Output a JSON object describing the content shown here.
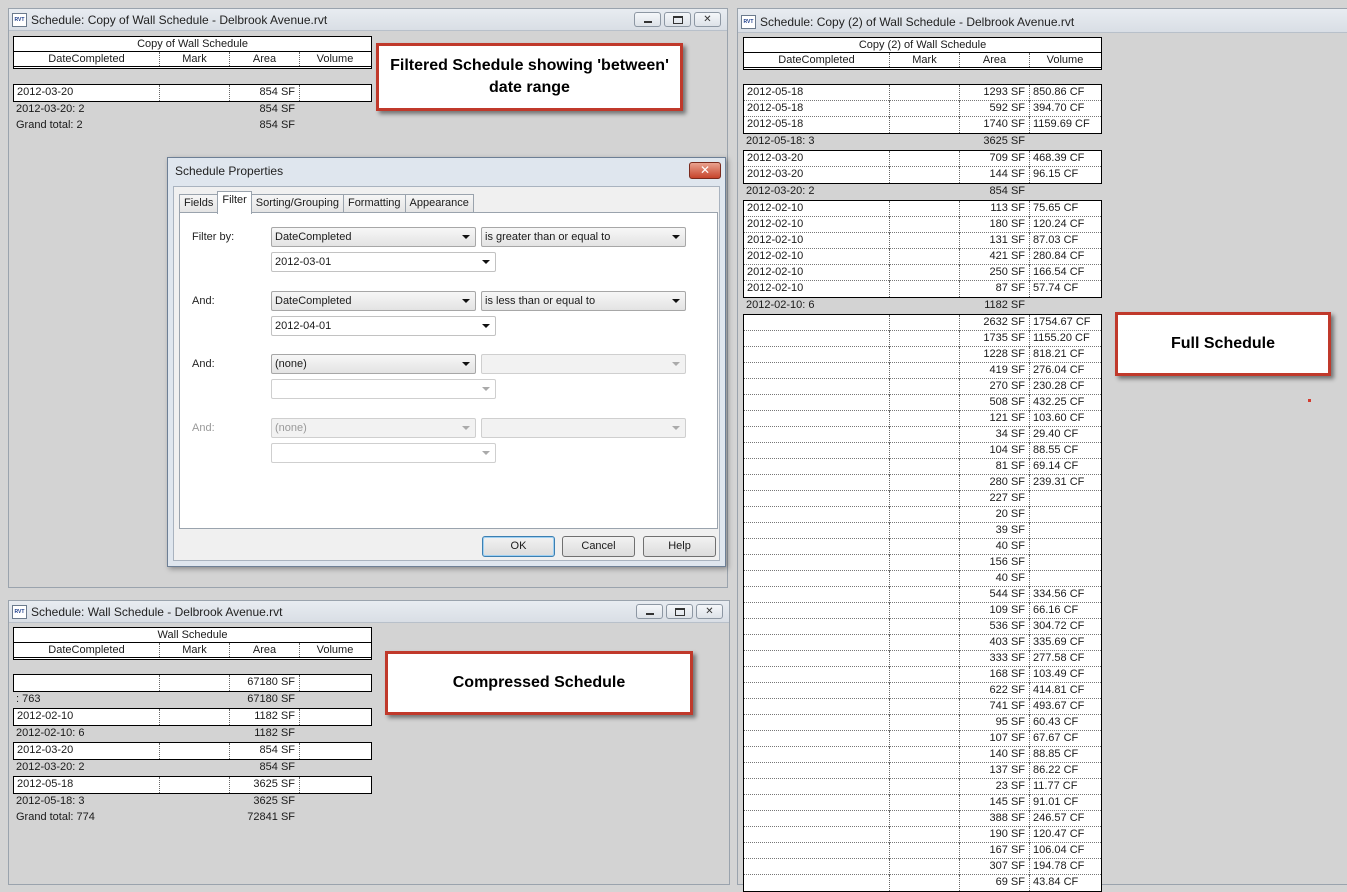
{
  "top_left_window": {
    "title": "Schedule: Copy of Wall Schedule - Delbrook Avenue.rvt",
    "schedule_title": "Copy of Wall Schedule",
    "columns": [
      "DateCompleted",
      "Mark",
      "Area",
      "Volume"
    ],
    "rows": [
      {
        "type": "data",
        "date": "2012-03-20",
        "mark": "",
        "area": "854 SF",
        "volume": ""
      },
      {
        "type": "summary",
        "date": "2012-03-20: 2",
        "mark": "",
        "area": "854 SF",
        "volume": ""
      },
      {
        "type": "summary",
        "date": "Grand total: 2",
        "mark": "",
        "area": "854 SF",
        "volume": ""
      }
    ]
  },
  "bottom_left_window": {
    "title": "Schedule: Wall Schedule - Delbrook Avenue.rvt",
    "schedule_title": "Wall Schedule",
    "columns": [
      "DateCompleted",
      "Mark",
      "Area",
      "Volume"
    ],
    "rows": [
      {
        "type": "data",
        "date": "",
        "area": "67180 SF"
      },
      {
        "type": "summary",
        "date": ": 763",
        "area": "67180 SF"
      },
      {
        "type": "data",
        "date": "2012-02-10",
        "area": "1182 SF"
      },
      {
        "type": "summary",
        "date": "2012-02-10: 6",
        "area": "1182 SF"
      },
      {
        "type": "data",
        "date": "2012-03-20",
        "area": "854 SF"
      },
      {
        "type": "summary",
        "date": "2012-03-20: 2",
        "area": "854 SF"
      },
      {
        "type": "data",
        "date": "2012-05-18",
        "area": "3625 SF"
      },
      {
        "type": "summary",
        "date": "2012-05-18: 3",
        "area": "3625 SF"
      },
      {
        "type": "summary",
        "date": "Grand total: 774",
        "area": "72841 SF"
      }
    ]
  },
  "right_window": {
    "title": "Schedule: Copy (2) of Wall Schedule - Delbrook Avenue.rvt",
    "schedule_title": "Copy (2) of Wall Schedule",
    "columns": [
      "DateCompleted",
      "Mark",
      "Area",
      "Volume"
    ],
    "groups": [
      {
        "rows": [
          [
            "2012-05-18",
            "1293 SF",
            "850.86 CF"
          ],
          [
            "2012-05-18",
            "592 SF",
            "394.70 CF"
          ],
          [
            "2012-05-18",
            "1740 SF",
            "1159.69 CF"
          ]
        ],
        "summary": [
          "2012-05-18: 3",
          "3625 SF"
        ]
      },
      {
        "rows": [
          [
            "2012-03-20",
            "709 SF",
            "468.39 CF"
          ],
          [
            "2012-03-20",
            "144 SF",
            "96.15 CF"
          ]
        ],
        "summary": [
          "2012-03-20: 2",
          "854 SF"
        ]
      },
      {
        "rows": [
          [
            "2012-02-10",
            "113 SF",
            "75.65 CF"
          ],
          [
            "2012-02-10",
            "180 SF",
            "120.24 CF"
          ],
          [
            "2012-02-10",
            "131 SF",
            "87.03 CF"
          ],
          [
            "2012-02-10",
            "421 SF",
            "280.84 CF"
          ],
          [
            "2012-02-10",
            "250 SF",
            "166.54 CF"
          ],
          [
            "2012-02-10",
            "87 SF",
            "57.74 CF"
          ]
        ],
        "summary": [
          "2012-02-10: 6",
          "1182 SF"
        ]
      },
      {
        "rows": [
          [
            "",
            "2632 SF",
            "1754.67 CF"
          ],
          [
            "",
            "1735 SF",
            "1155.20 CF"
          ],
          [
            "",
            "1228 SF",
            "818.21 CF"
          ],
          [
            "",
            "419 SF",
            "276.04 CF"
          ],
          [
            "",
            "270 SF",
            "230.28 CF"
          ],
          [
            "",
            "508 SF",
            "432.25 CF"
          ],
          [
            "",
            "121 SF",
            "103.60 CF"
          ],
          [
            "",
            "34 SF",
            "29.40 CF"
          ],
          [
            "",
            "104 SF",
            "88.55 CF"
          ],
          [
            "",
            "81 SF",
            "69.14 CF"
          ],
          [
            "",
            "280 SF",
            "239.31 CF"
          ],
          [
            "",
            "227 SF",
            ""
          ],
          [
            "",
            "20 SF",
            ""
          ],
          [
            "",
            "39 SF",
            ""
          ],
          [
            "",
            "40 SF",
            ""
          ],
          [
            "",
            "156 SF",
            ""
          ],
          [
            "",
            "40 SF",
            ""
          ],
          [
            "",
            "544 SF",
            "334.56 CF"
          ],
          [
            "",
            "109 SF",
            "66.16 CF"
          ],
          [
            "",
            "536 SF",
            "304.72 CF"
          ],
          [
            "",
            "403 SF",
            "335.69 CF"
          ],
          [
            "",
            "333 SF",
            "277.58 CF"
          ],
          [
            "",
            "168 SF",
            "103.49 CF"
          ],
          [
            "",
            "622 SF",
            "414.81 CF"
          ],
          [
            "",
            "741 SF",
            "493.67 CF"
          ],
          [
            "",
            "95 SF",
            "60.43 CF"
          ],
          [
            "",
            "107 SF",
            "67.67 CF"
          ],
          [
            "",
            "140 SF",
            "88.85 CF"
          ],
          [
            "",
            "137 SF",
            "86.22 CF"
          ],
          [
            "",
            "23 SF",
            "11.77 CF"
          ],
          [
            "",
            "145 SF",
            "91.01 CF"
          ],
          [
            "",
            "388 SF",
            "246.57 CF"
          ],
          [
            "",
            "190 SF",
            "120.47 CF"
          ],
          [
            "",
            "167 SF",
            "106.04 CF"
          ],
          [
            "",
            "307 SF",
            "194.78 CF"
          ],
          [
            "",
            "69 SF",
            "43.84 CF"
          ]
        ],
        "summary": null
      }
    ]
  },
  "callouts": {
    "filtered": "Filtered Schedule showing 'between' date range",
    "compressed": "Compressed Schedule",
    "full": "Full Schedule"
  },
  "dialog": {
    "title": "Schedule Properties",
    "close_glyph": "✕",
    "tabs": [
      "Fields",
      "Filter",
      "Sorting/Grouping",
      "Formatting",
      "Appearance"
    ],
    "active_tab": "Filter",
    "filters": [
      {
        "label": "Filter by:",
        "field": "DateCompleted",
        "operator": "is greater than or equal to",
        "value": "2012-03-01",
        "enabled": true
      },
      {
        "label": "And:",
        "field": "DateCompleted",
        "operator": "is less than or equal to",
        "value": "2012-04-01",
        "enabled": true
      },
      {
        "label": "And:",
        "field": "(none)",
        "operator": "",
        "value": "",
        "enabled": true
      },
      {
        "label": "And:",
        "field": "(none)",
        "operator": "",
        "value": "",
        "enabled": false
      }
    ],
    "buttons": {
      "ok": "OK",
      "cancel": "Cancel",
      "help": "Help"
    }
  },
  "window_buttons": {
    "close_glyph": "✕"
  },
  "app_icon_text": "RVT",
  "colors": {
    "callout_border": "#c0392b",
    "dialog_close": "#c7442c"
  }
}
